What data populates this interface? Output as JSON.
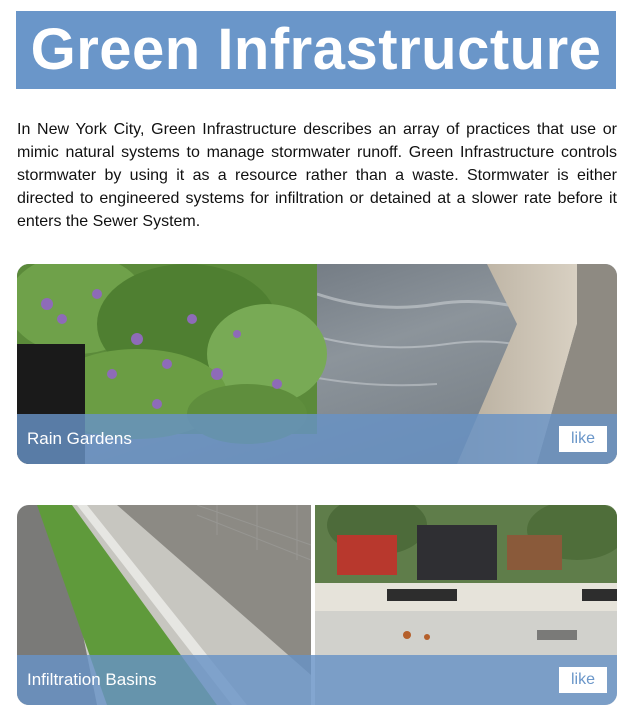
{
  "title": "Green Infrastructure",
  "intro": "In New York City, Green Infrastructure describes an array of practices that use or mimic natural systems to manage stormwater runoff. Green Infrastructure controls stormwater by using it as a resource rather than a waste. Stormwater is either directed to engineered systems for infiltration or detained at a slower rate before it enters the Sewer System.",
  "cards": [
    {
      "label": "Rain Gardens",
      "like_label": "like"
    },
    {
      "label": "Infiltration Basins",
      "like_label": "like"
    }
  ],
  "colors": {
    "banner": "#6a96c9",
    "caption_overlay": "#6892c6",
    "like_text": "#6a96c9"
  }
}
